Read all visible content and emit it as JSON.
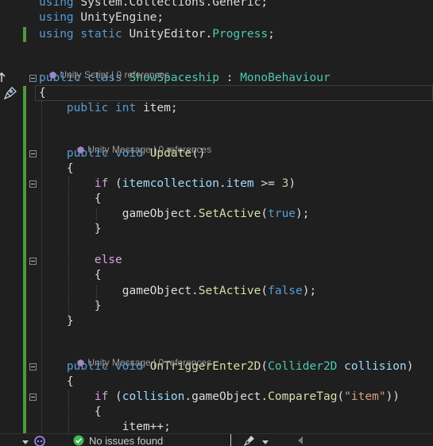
{
  "editor": {
    "lines": [
      [
        [
          "kw",
          "using"
        ],
        [
          "pl",
          " System.Collections.Generic;"
        ]
      ],
      [
        [
          "kw",
          "using"
        ],
        [
          "pl",
          " UnityEngine;"
        ]
      ],
      [
        [
          "kw",
          "using static"
        ],
        [
          "pl",
          " UnityEditor."
        ],
        [
          "typ",
          "Progress"
        ],
        [
          "pl",
          ";"
        ]
      ],
      [
        [
          "kw",
          "public class "
        ],
        [
          "typ",
          "ShowSpaceship"
        ],
        [
          "pl",
          " : "
        ],
        [
          "typ",
          "MonoBehaviour"
        ]
      ],
      [
        [
          "pl",
          "{"
        ]
      ],
      [
        [
          "kw",
          "    public int "
        ],
        [
          "pl",
          "item;"
        ]
      ],
      [
        [
          "kw",
          "    public void "
        ],
        [
          "mth",
          "Update"
        ],
        [
          "pl",
          "()"
        ]
      ],
      [
        [
          "pl",
          "    {"
        ]
      ],
      [
        [
          "ctl",
          "        if"
        ],
        [
          "pl",
          " ("
        ],
        [
          "id",
          "itemcollection"
        ],
        [
          "pl",
          "."
        ],
        [
          "id",
          "item"
        ],
        [
          "pl",
          " >= "
        ],
        [
          "num",
          "3"
        ],
        [
          "pl",
          ")"
        ]
      ],
      [
        [
          "pl",
          "        {"
        ]
      ],
      [
        [
          "pl",
          "            gameObject."
        ],
        [
          "mth",
          "SetActive"
        ],
        [
          "pl",
          "("
        ],
        [
          "kw",
          "true"
        ],
        [
          "pl",
          ");"
        ]
      ],
      [
        [
          "pl",
          "        }"
        ]
      ],
      [
        [
          "ctl",
          "        else"
        ]
      ],
      [
        [
          "pl",
          "        {"
        ]
      ],
      [
        [
          "pl",
          "            gameObject."
        ],
        [
          "mth",
          "SetActive"
        ],
        [
          "pl",
          "("
        ],
        [
          "kw",
          "false"
        ],
        [
          "pl",
          ");"
        ]
      ],
      [
        [
          "pl",
          "        }"
        ]
      ],
      [
        [
          "pl",
          "    }"
        ]
      ],
      [
        [
          "kw",
          "    public void "
        ],
        [
          "mth",
          "OnTriggerEnter2D"
        ],
        [
          "pl",
          "("
        ],
        [
          "typ",
          "Collider2D"
        ],
        [
          "pl",
          " "
        ],
        [
          "id",
          "collision"
        ],
        [
          "pl",
          ")"
        ]
      ],
      [
        [
          "pl",
          "    {"
        ]
      ],
      [
        [
          "ctl",
          "        if"
        ],
        [
          "pl",
          " ("
        ],
        [
          "id",
          "collision"
        ],
        [
          "pl",
          ".gameObject."
        ],
        [
          "mth",
          "CompareTag"
        ],
        [
          "pl",
          "("
        ],
        [
          "str",
          "\"item\""
        ],
        [
          "pl",
          "))"
        ]
      ],
      [
        [
          "pl",
          "        {"
        ]
      ],
      [
        [
          "pl",
          "            item++;"
        ]
      ]
    ],
    "codelens": [
      {
        "kind": "Unity Script",
        "refs": "0 references",
        "sep": " | "
      },
      {
        "kind": "Unity Message",
        "refs": "0 references",
        "sep": " | "
      },
      {
        "kind": "Unity Message",
        "refs": "0 references",
        "sep": " | "
      }
    ]
  },
  "statusbar": {
    "issues_text": "No issues found",
    "issues_icon": "check-circle-icon",
    "brush_icon": "code-cleanup-brush-icon",
    "copilot_icon": "copilot-icon"
  },
  "colors": {
    "keyword": "#569cd6",
    "control": "#d8a0df",
    "type": "#4ec9b0",
    "method": "#dcdcaa",
    "identifier": "#9cdcfe",
    "number": "#b5cea8",
    "string": "#d69d85",
    "background": "#1f1f1f",
    "change_bar": "#4a9a3c",
    "ok": "#3fb950"
  }
}
